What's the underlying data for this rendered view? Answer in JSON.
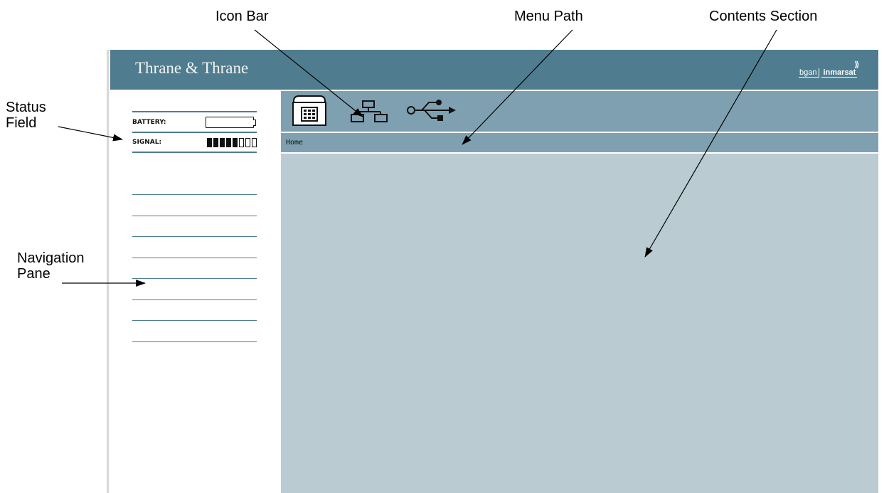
{
  "annotations": {
    "icon_bar": "Icon Bar",
    "menu_path": "Menu Path",
    "contents_section": "Contents Section",
    "status_field_line1": "Status",
    "status_field_line2": "Field",
    "navigation_pane_line1": "Navigation",
    "navigation_pane_line2": "Pane"
  },
  "header": {
    "brand": "Thrane & Thrane",
    "logo_bgan": "bgan",
    "logo_inmarsat": "inmarsat"
  },
  "status": {
    "battery_label": "BATTERY:",
    "signal_label": "SIGNAL:",
    "signal_bars_filled": 5,
    "signal_bars_total": 8
  },
  "nav": {
    "items": [
      "",
      "",
      "",
      "",
      "",
      "",
      "",
      ""
    ]
  },
  "icons": [
    "phone-icon",
    "network-icon",
    "usb-icon"
  ],
  "menu_path": {
    "text": "Home"
  },
  "colors": {
    "header": "#4f7d8f",
    "iconbar": "#7fa0b1",
    "contents": "#bacbd2"
  }
}
